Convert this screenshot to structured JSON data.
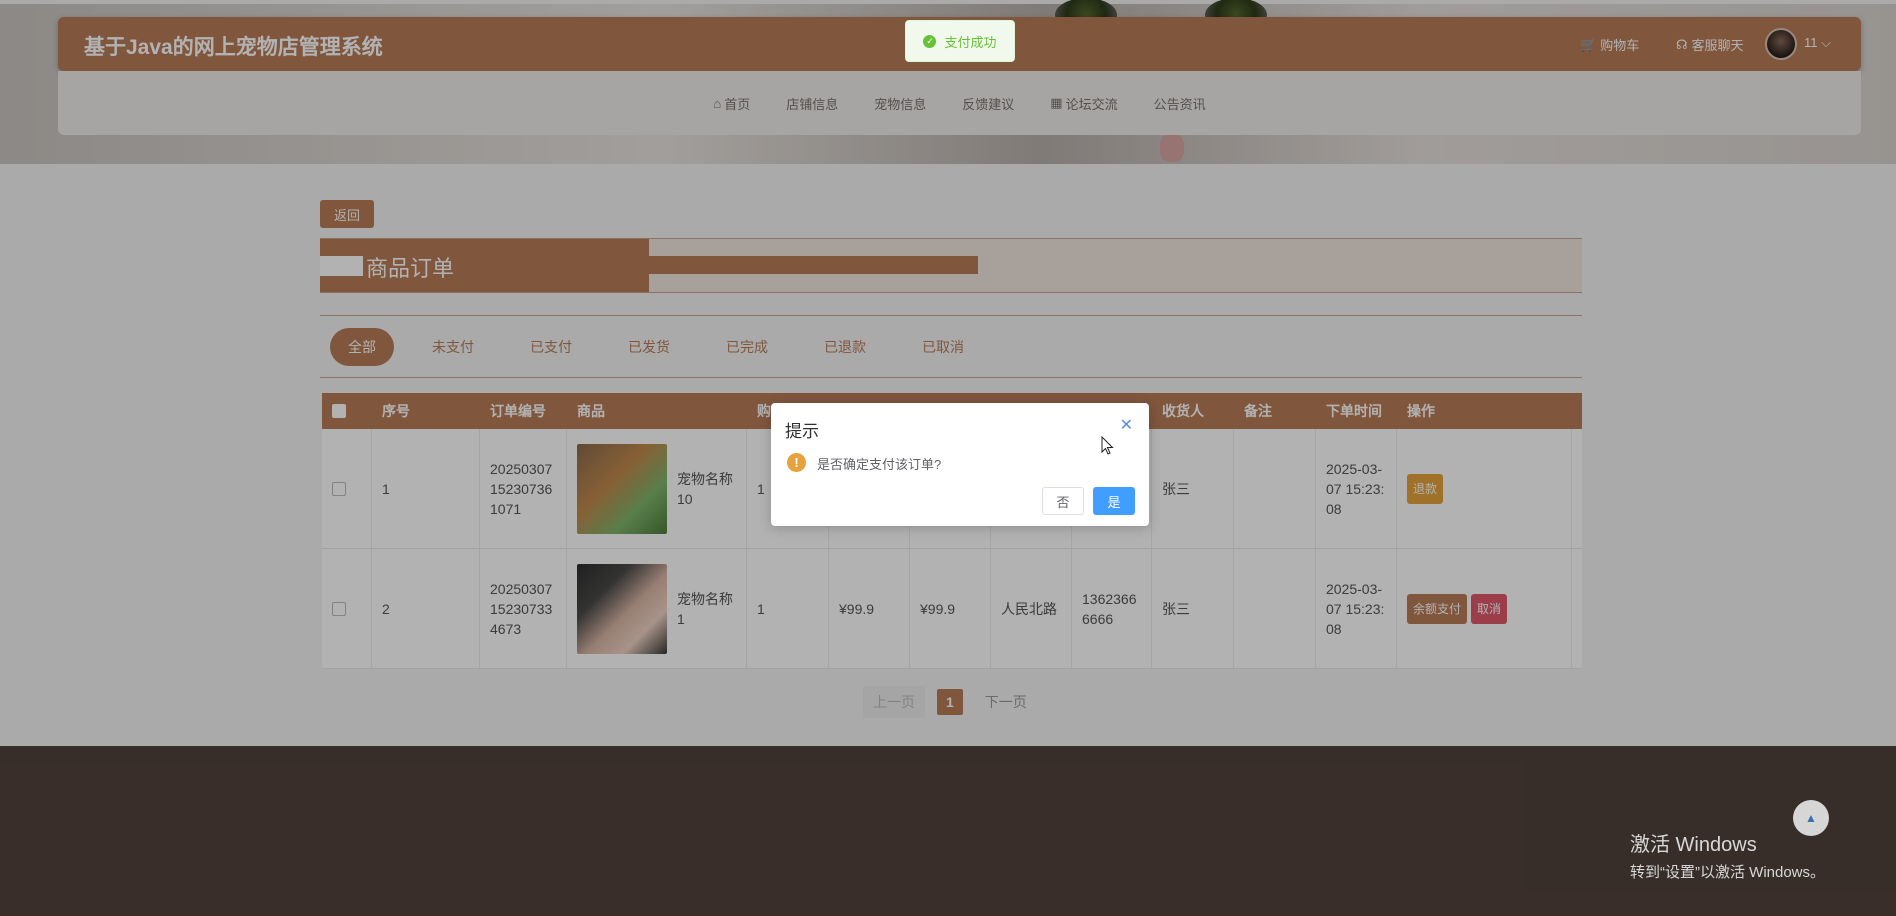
{
  "header": {
    "site_title": "基于Java的网上宠物店管理系统",
    "cart_label": "购物车",
    "chat_label": "客服聊天",
    "user_name": "11"
  },
  "nav": {
    "items": [
      "首页",
      "店铺信息",
      "宠物信息",
      "反馈建议",
      "论坛交流",
      "公告资讯"
    ]
  },
  "page": {
    "back_label": "返回",
    "title": "商品订单"
  },
  "tabs": [
    "全部",
    "未支付",
    "已支付",
    "已发货",
    "已完成",
    "已退款",
    "已取消"
  ],
  "table": {
    "columns": [
      "序号",
      "订单编号",
      "商品",
      "购",
      "收货人",
      "备注",
      "下单时间",
      "操作"
    ],
    "rows": [
      {
        "index": "1",
        "order_no": "20250307152307361071",
        "product": "宠物名称10",
        "qty": "1",
        "receiver": "张三",
        "time": "2025-03-07 15:23:08",
        "actions": [
          "退款"
        ]
      },
      {
        "index": "2",
        "order_no": "20250307152307334673",
        "product": "宠物名称1",
        "qty": "1",
        "price": "¥99.9",
        "total": "¥99.9",
        "address": "人民北路",
        "phone": "13623666666",
        "receiver": "张三",
        "time": "2025-03-07 15:23:08",
        "actions": [
          "余额支付",
          "取消"
        ]
      }
    ]
  },
  "pager": {
    "prev": "上一页",
    "current": "1",
    "next": "下一页"
  },
  "toast": {
    "message": "支付成功"
  },
  "dialog": {
    "title": "提示",
    "message": "是否确定支付该订单?",
    "cancel": "否",
    "confirm": "是"
  },
  "watermark": {
    "line1": "激活 Windows",
    "line2": "转到“设置”以激活 Windows。"
  },
  "colors": {
    "brand": "#b87b58",
    "footer": "#51423b",
    "primary_button": "#409eff",
    "warning": "#e6a23c",
    "danger": "#e05a6a",
    "success": "#67c23a"
  }
}
